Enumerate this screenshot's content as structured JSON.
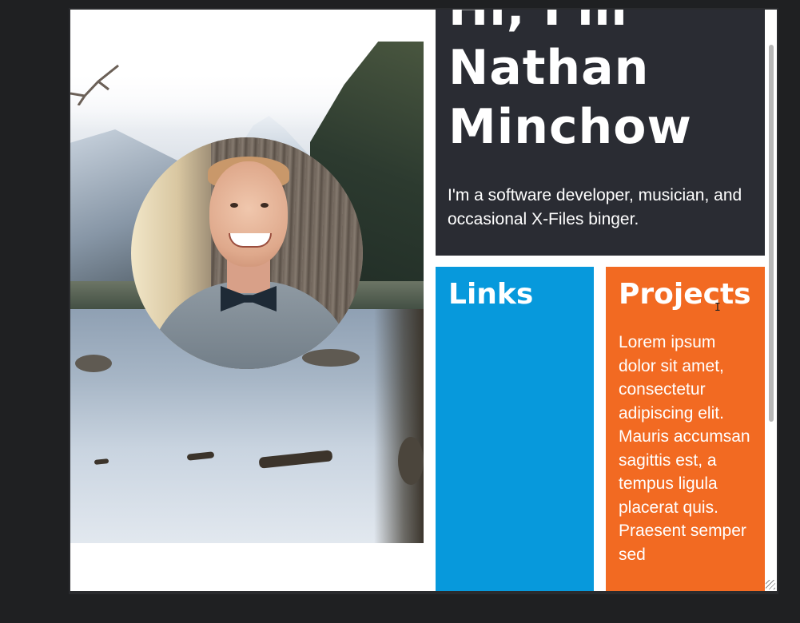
{
  "hero": {
    "title": "Hi, I'm\nNathan\nMinchow",
    "tagline": "I'm a software developer, musician, and occasional X-Files binger."
  },
  "links": {
    "heading": "Links"
  },
  "projects": {
    "heading": "Projects",
    "body": "Lorem ipsum dolor sit amet, consectetur adipiscing elit. Mauris accumsan sagittis est, a tempus ligula placerat quis. Praesent semper sed"
  },
  "colors": {
    "hero_bg": "#2a2c33",
    "links_bg": "#0799dc",
    "projects_bg": "#f26a22",
    "page_bg": "#1f2022"
  },
  "icons": {
    "cursor": "text-cursor-icon",
    "resize": "resize-grip-icon"
  }
}
